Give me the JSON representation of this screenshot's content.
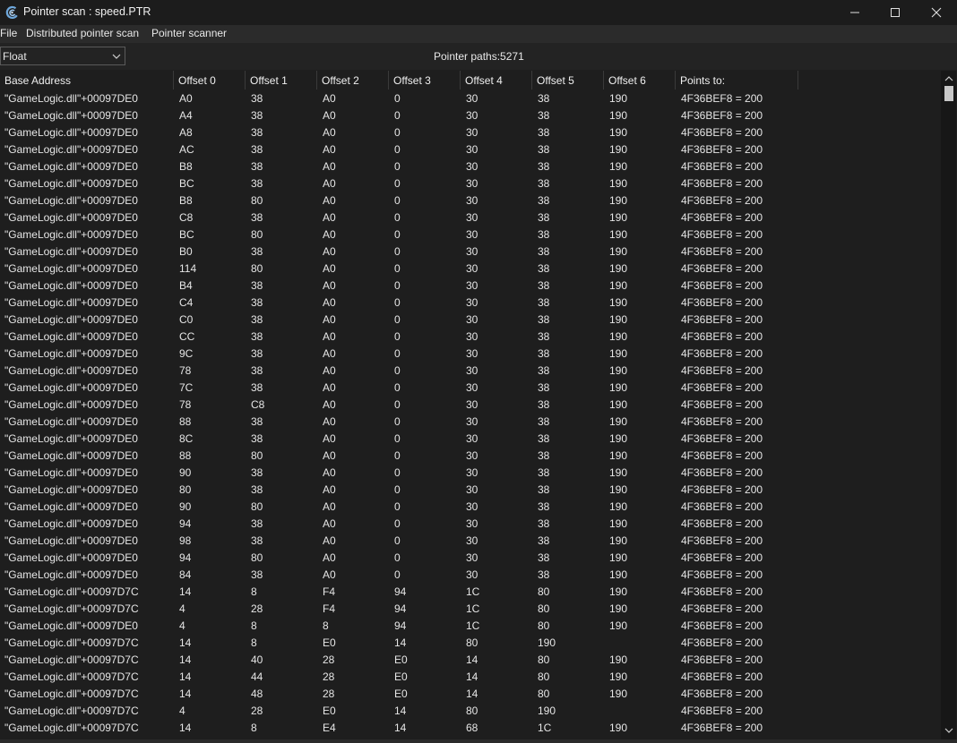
{
  "window": {
    "title": "Pointer scan : speed.PTR",
    "app_icon": "cheat-engine-icon"
  },
  "menu": [
    "File",
    "Distributed pointer scan",
    "Pointer scanner"
  ],
  "toolbar": {
    "value_type": "Float",
    "pointer_paths": "Pointer paths:5271"
  },
  "table": {
    "columns": [
      "Base Address",
      "Offset 0",
      "Offset 1",
      "Offset 2",
      "Offset 3",
      "Offset 4",
      "Offset 5",
      "Offset 6",
      "Points to:"
    ],
    "rows": [
      [
        "\"GameLogic.dll\"+00097DE0",
        "A0",
        "38",
        "A0",
        "0",
        "30",
        "38",
        "190",
        "4F36BEF8 = 200"
      ],
      [
        "\"GameLogic.dll\"+00097DE0",
        "A4",
        "38",
        "A0",
        "0",
        "30",
        "38",
        "190",
        "4F36BEF8 = 200"
      ],
      [
        "\"GameLogic.dll\"+00097DE0",
        "A8",
        "38",
        "A0",
        "0",
        "30",
        "38",
        "190",
        "4F36BEF8 = 200"
      ],
      [
        "\"GameLogic.dll\"+00097DE0",
        "AC",
        "38",
        "A0",
        "0",
        "30",
        "38",
        "190",
        "4F36BEF8 = 200"
      ],
      [
        "\"GameLogic.dll\"+00097DE0",
        "B8",
        "38",
        "A0",
        "0",
        "30",
        "38",
        "190",
        "4F36BEF8 = 200"
      ],
      [
        "\"GameLogic.dll\"+00097DE0",
        "BC",
        "38",
        "A0",
        "0",
        "30",
        "38",
        "190",
        "4F36BEF8 = 200"
      ],
      [
        "\"GameLogic.dll\"+00097DE0",
        "B8",
        "80",
        "A0",
        "0",
        "30",
        "38",
        "190",
        "4F36BEF8 = 200"
      ],
      [
        "\"GameLogic.dll\"+00097DE0",
        "C8",
        "38",
        "A0",
        "0",
        "30",
        "38",
        "190",
        "4F36BEF8 = 200"
      ],
      [
        "\"GameLogic.dll\"+00097DE0",
        "BC",
        "80",
        "A0",
        "0",
        "30",
        "38",
        "190",
        "4F36BEF8 = 200"
      ],
      [
        "\"GameLogic.dll\"+00097DE0",
        "B0",
        "38",
        "A0",
        "0",
        "30",
        "38",
        "190",
        "4F36BEF8 = 200"
      ],
      [
        "\"GameLogic.dll\"+00097DE0",
        "114",
        "80",
        "A0",
        "0",
        "30",
        "38",
        "190",
        "4F36BEF8 = 200"
      ],
      [
        "\"GameLogic.dll\"+00097DE0",
        "B4",
        "38",
        "A0",
        "0",
        "30",
        "38",
        "190",
        "4F36BEF8 = 200"
      ],
      [
        "\"GameLogic.dll\"+00097DE0",
        "C4",
        "38",
        "A0",
        "0",
        "30",
        "38",
        "190",
        "4F36BEF8 = 200"
      ],
      [
        "\"GameLogic.dll\"+00097DE0",
        "C0",
        "38",
        "A0",
        "0",
        "30",
        "38",
        "190",
        "4F36BEF8 = 200"
      ],
      [
        "\"GameLogic.dll\"+00097DE0",
        "CC",
        "38",
        "A0",
        "0",
        "30",
        "38",
        "190",
        "4F36BEF8 = 200"
      ],
      [
        "\"GameLogic.dll\"+00097DE0",
        "9C",
        "38",
        "A0",
        "0",
        "30",
        "38",
        "190",
        "4F36BEF8 = 200"
      ],
      [
        "\"GameLogic.dll\"+00097DE0",
        "78",
        "38",
        "A0",
        "0",
        "30",
        "38",
        "190",
        "4F36BEF8 = 200"
      ],
      [
        "\"GameLogic.dll\"+00097DE0",
        "7C",
        "38",
        "A0",
        "0",
        "30",
        "38",
        "190",
        "4F36BEF8 = 200"
      ],
      [
        "\"GameLogic.dll\"+00097DE0",
        "78",
        "C8",
        "A0",
        "0",
        "30",
        "38",
        "190",
        "4F36BEF8 = 200"
      ],
      [
        "\"GameLogic.dll\"+00097DE0",
        "88",
        "38",
        "A0",
        "0",
        "30",
        "38",
        "190",
        "4F36BEF8 = 200"
      ],
      [
        "\"GameLogic.dll\"+00097DE0",
        "8C",
        "38",
        "A0",
        "0",
        "30",
        "38",
        "190",
        "4F36BEF8 = 200"
      ],
      [
        "\"GameLogic.dll\"+00097DE0",
        "88",
        "80",
        "A0",
        "0",
        "30",
        "38",
        "190",
        "4F36BEF8 = 200"
      ],
      [
        "\"GameLogic.dll\"+00097DE0",
        "90",
        "38",
        "A0",
        "0",
        "30",
        "38",
        "190",
        "4F36BEF8 = 200"
      ],
      [
        "\"GameLogic.dll\"+00097DE0",
        "80",
        "38",
        "A0",
        "0",
        "30",
        "38",
        "190",
        "4F36BEF8 = 200"
      ],
      [
        "\"GameLogic.dll\"+00097DE0",
        "90",
        "80",
        "A0",
        "0",
        "30",
        "38",
        "190",
        "4F36BEF8 = 200"
      ],
      [
        "\"GameLogic.dll\"+00097DE0",
        "94",
        "38",
        "A0",
        "0",
        "30",
        "38",
        "190",
        "4F36BEF8 = 200"
      ],
      [
        "\"GameLogic.dll\"+00097DE0",
        "98",
        "38",
        "A0",
        "0",
        "30",
        "38",
        "190",
        "4F36BEF8 = 200"
      ],
      [
        "\"GameLogic.dll\"+00097DE0",
        "94",
        "80",
        "A0",
        "0",
        "30",
        "38",
        "190",
        "4F36BEF8 = 200"
      ],
      [
        "\"GameLogic.dll\"+00097DE0",
        "84",
        "38",
        "A0",
        "0",
        "30",
        "38",
        "190",
        "4F36BEF8 = 200"
      ],
      [
        "\"GameLogic.dll\"+00097D7C",
        "14",
        "8",
        "F4",
        "94",
        "1C",
        "80",
        "190",
        "4F36BEF8 = 200"
      ],
      [
        "\"GameLogic.dll\"+00097D7C",
        "4",
        "28",
        "F4",
        "94",
        "1C",
        "80",
        "190",
        "4F36BEF8 = 200"
      ],
      [
        "\"GameLogic.dll\"+00097DE0",
        "4",
        "8",
        "8",
        "94",
        "1C",
        "80",
        "190",
        "4F36BEF8 = 200"
      ],
      [
        "\"GameLogic.dll\"+00097D7C",
        "14",
        "8",
        "E0",
        "14",
        "80",
        "190",
        "",
        "4F36BEF8 = 200"
      ],
      [
        "\"GameLogic.dll\"+00097D7C",
        "14",
        "40",
        "28",
        "E0",
        "14",
        "80",
        "190",
        "4F36BEF8 = 200"
      ],
      [
        "\"GameLogic.dll\"+00097D7C",
        "14",
        "44",
        "28",
        "E0",
        "14",
        "80",
        "190",
        "4F36BEF8 = 200"
      ],
      [
        "\"GameLogic.dll\"+00097D7C",
        "14",
        "48",
        "28",
        "E0",
        "14",
        "80",
        "190",
        "4F36BEF8 = 200"
      ],
      [
        "\"GameLogic.dll\"+00097D7C",
        "4",
        "28",
        "E0",
        "14",
        "80",
        "190",
        "",
        "4F36BEF8 = 200"
      ],
      [
        "\"GameLogic.dll\"+00097D7C",
        "14",
        "8",
        "E4",
        "14",
        "68",
        "1C",
        "190",
        "4F36BEF8 = 200"
      ]
    ]
  }
}
